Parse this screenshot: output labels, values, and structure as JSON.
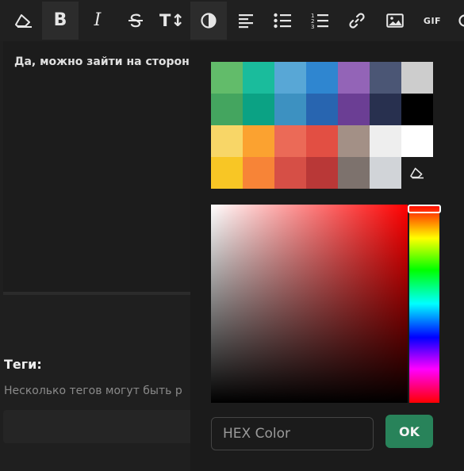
{
  "toolbar": {
    "items": [
      {
        "name": "eraser-icon"
      },
      {
        "name": "bold-icon",
        "label": "B"
      },
      {
        "name": "italic-icon",
        "label": "I"
      },
      {
        "name": "strikethrough-icon"
      },
      {
        "name": "text-size-icon",
        "label": "T↕"
      },
      {
        "name": "contrast-icon"
      },
      {
        "name": "align-left-icon"
      },
      {
        "name": "bullet-list-icon"
      },
      {
        "name": "numbered-list-icon"
      },
      {
        "name": "link-icon"
      },
      {
        "name": "image-icon"
      },
      {
        "name": "gif-icon",
        "label": "GIF"
      }
    ]
  },
  "editor": {
    "text": "Да, можно зайти на сторон"
  },
  "tags": {
    "title": "Теги:",
    "hint": "Несколько тегов могут быть р"
  },
  "picker": {
    "swatches": [
      "#62bc6a",
      "#1abc9c",
      "#58a7d6",
      "#2f86d0",
      "#9364b7",
      "#4b5675",
      "#cdcdcd",
      "#44a55f",
      "#0ba284",
      "#3d91c1",
      "#2865b0",
      "#6b3e94",
      "#28304f",
      "#000000",
      "#f8d667",
      "#fba230",
      "#eb6a57",
      "#e24f43",
      "#a39086",
      "#eeeeee",
      "#ffffff",
      "#f8c625",
      "#f78437",
      "#d64f46",
      "#b93837",
      "#7d726d",
      "#d1d4d8"
    ],
    "clear_icon": "eraser-icon",
    "hex_placeholder": "HEX Color",
    "ok_label": "OK"
  }
}
